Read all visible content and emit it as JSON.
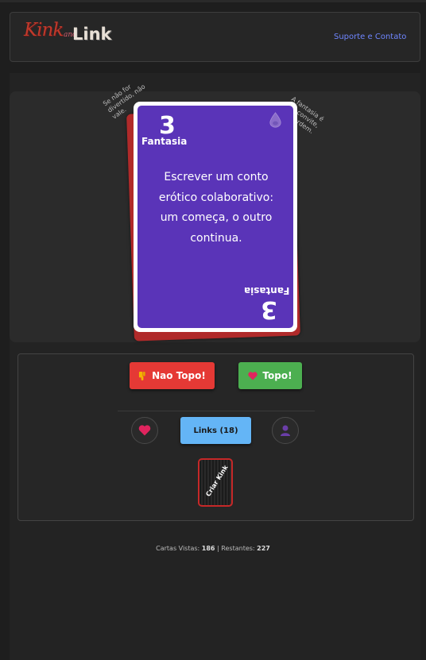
{
  "header": {
    "logo_word_1": "Kink",
    "logo_connector": "and",
    "logo_word_2": "Link",
    "support_link": "Suporte e Contato"
  },
  "card": {
    "number": "3",
    "category": "Fantasia",
    "text": "Escrever um conto erótico colaborativo: um começa, o outro continua.",
    "left_hint": "Se não for divertido, não vale.",
    "right_hint": "A fantasia é um convite, não ordem.",
    "card_color": "#5a34b8",
    "icon": "drop-icon"
  },
  "actions": {
    "dislike_label": "Nao Topo!",
    "dislike_icon": "thumbs-down-icon",
    "like_label": "Topo!",
    "like_icon": "heart-icon",
    "links_label": "Links (18)",
    "favorites_icon": "heart-icon",
    "profile_icon": "user-icon",
    "create_kink_label": "Criar Kink"
  },
  "stats": {
    "seen_label": "Cartas Vistas:",
    "seen_value": "186",
    "separator": "|",
    "remaining_label": "Restantes:",
    "remaining_value": "227"
  }
}
